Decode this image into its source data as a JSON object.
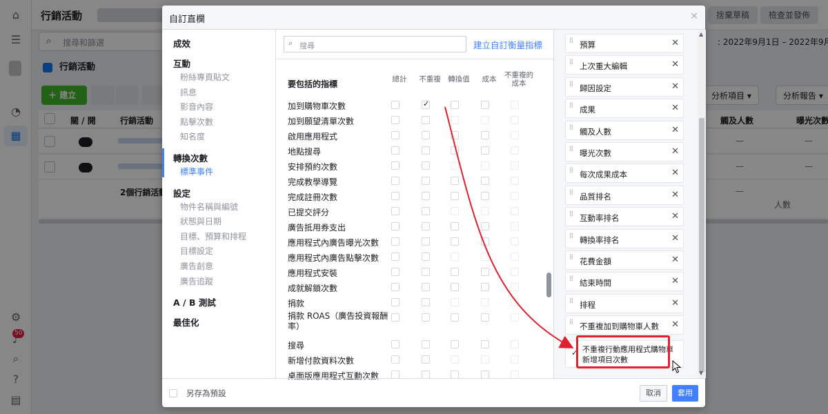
{
  "app": {
    "title": "行銷活動",
    "search_placeholder": "搜尋和篩選",
    "date_range": ": 2022年9月1日 – 2022年9月5日",
    "campaign_tab": "行銷活動",
    "create_button": "建立",
    "top_buttons": [
      "捨棄草稿",
      "檢查並發佈"
    ],
    "right_buttons": [
      "分析項目",
      "分析報告"
    ],
    "table_headers": [
      "關 / 開",
      "行銷活動",
      "觸及人數",
      "曝光次數"
    ],
    "summary_text": "2個行銷活動",
    "summary_sub": "人數",
    "dash": "—",
    "notification_count": "50"
  },
  "modal": {
    "title": "自訂直欄",
    "categories": [
      {
        "heading": "成效",
        "items": []
      },
      {
        "heading": "互動",
        "items": [
          "粉絲專頁貼文",
          "訊息",
          "影音內容",
          "點擊次數",
          "知名度"
        ]
      },
      {
        "heading": "轉換次數",
        "items": [
          "標準事件"
        ]
      },
      {
        "heading": "設定",
        "items": [
          "物件名稱與編號",
          "狀態與日期",
          "目標、預算和排程",
          "目標設定",
          "廣告創意",
          "廣告追蹤"
        ]
      },
      {
        "heading": "A / B 測試",
        "items": []
      },
      {
        "heading": "最佳化",
        "items": []
      }
    ],
    "search_placeholder": "搜尋",
    "custom_metric_link": "建立自訂衡量指標",
    "metrics_heading": "要包括的指標",
    "columns": [
      "總計",
      "不重複",
      "轉換值",
      "成本",
      "不重複的成本"
    ],
    "metrics": [
      "加到購物車次數",
      "加到願望清單次數",
      "啟用應用程式",
      "地點搜尋",
      "安排預約次數",
      "完成教學導覽",
      "完成註冊次數",
      "已提交評分",
      "廣告抵用券支出",
      "應用程式內廣告曝光次數",
      "應用程式內廣告點擊次數",
      "應用程式安裝",
      "成就解鎖次數",
      "捐款",
      "捐款 ROAS（廣告投資報酬率）",
      "搜尋",
      "新增付款資料次數",
      "桌面版應用程式互動次數"
    ],
    "checked_cell": {
      "metric_index": 0,
      "column_index": 1
    },
    "selected_columns": [
      "預算",
      "上次重大編輯",
      "歸因設定",
      "成果",
      "觸及人數",
      "曝光次數",
      "每次成果成本",
      "品質排名",
      "互動率排名",
      "轉換率排名",
      "花費金額",
      "結束時間",
      "排程",
      "不重複加到購物車人數"
    ],
    "new_column": "不重複行動應用程式購物車新增項目次數",
    "save_preset": "另存為預設",
    "cancel": "取消",
    "apply": "套用"
  },
  "icons": {
    "remove": "close-icon",
    "drag": "drag-handle-icon",
    "check": "check-icon"
  },
  "colors": {
    "accent": "#4080ff",
    "highlight": "#e0202e",
    "create_green": "#42b72a"
  }
}
